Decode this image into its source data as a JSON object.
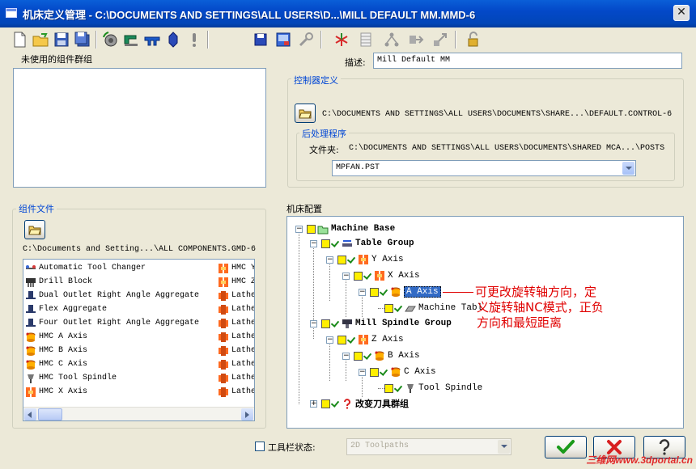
{
  "window": {
    "title": "机床定义管理 - C:\\DOCUMENTS AND SETTINGS\\ALL USERS\\D...\\MILL DEFAULT MM.MMD-6",
    "close": "✕"
  },
  "unused_group": {
    "label": "未使用的组件群组"
  },
  "description": {
    "label": "描述:",
    "value": "Mill Default MM"
  },
  "controller": {
    "label": "控制器定义",
    "path": "C:\\DOCUMENTS AND SETTINGS\\ALL USERS\\DOCUMENTS\\SHARE...\\DEFAULT.CONTROL-6"
  },
  "post": {
    "label": "后处理程序",
    "folder_label": "文件夹:",
    "folder_path": "C:\\DOCUMENTS AND SETTINGS\\ALL USERS\\DOCUMENTS\\SHARED MCA...\\POSTS",
    "selected": "MPFAN.PST"
  },
  "component_file": {
    "label": "组件文件",
    "path": "C:\\Documents and Setting...\\ALL COMPONENTS.GMD-6"
  },
  "component_list": {
    "left": [
      {
        "label": "Automatic Tool Changer",
        "icon": "tool-changer-icon"
      },
      {
        "label": "Drill Block",
        "icon": "drill-block-icon"
      },
      {
        "label": "Dual Outlet Right Angle Aggregate",
        "icon": "aggregate-icon"
      },
      {
        "label": "Flex Aggregate",
        "icon": "aggregate-icon"
      },
      {
        "label": "Four Outlet Right Angle Aggregate",
        "icon": "aggregate-icon"
      },
      {
        "label": "HMC A Axis",
        "icon": "rotary-axis-icon"
      },
      {
        "label": "HMC B Axis",
        "icon": "rotary-axis-icon"
      },
      {
        "label": "HMC C Axis",
        "icon": "rotary-axis-icon"
      },
      {
        "label": "HMC Tool Spindle",
        "icon": "spindle-icon"
      },
      {
        "label": "HMC X Axis",
        "icon": "linear-axis-icon"
      }
    ],
    "right": [
      {
        "label": "HMC Y",
        "icon": "linear-axis-icon"
      },
      {
        "label": "HMC Z",
        "icon": "linear-axis-icon"
      },
      {
        "label": "Lathe",
        "icon": "lathe-icon"
      },
      {
        "label": "Lathe",
        "icon": "lathe-icon"
      },
      {
        "label": "Lathe",
        "icon": "lathe-icon"
      },
      {
        "label": "Lathe",
        "icon": "lathe-icon"
      },
      {
        "label": "Lathe",
        "icon": "lathe-icon"
      },
      {
        "label": "Lathe",
        "icon": "lathe-icon"
      },
      {
        "label": "Lathe",
        "icon": "lathe-icon"
      },
      {
        "label": "Lathe",
        "icon": "lathe-icon"
      }
    ]
  },
  "machine_config": {
    "label": "机床配置",
    "nodes": [
      {
        "label": "Machine Base",
        "icon": "machine-base-icon"
      },
      {
        "label": "Table Group",
        "icon": "table-group-icon"
      },
      {
        "label": "Y Axis",
        "icon": "linear-axis-icon"
      },
      {
        "label": "X Axis",
        "icon": "linear-axis-icon"
      },
      {
        "label": "A Axis",
        "icon": "rotary-axis-icon"
      },
      {
        "label": "Machine Tabl",
        "icon": "machine-table-icon"
      },
      {
        "label": "Mill Spindle Group",
        "icon": "spindle-group-icon"
      },
      {
        "label": "Z Axis",
        "icon": "linear-axis-icon"
      },
      {
        "label": "B Axis",
        "icon": "rotary-axis-icon"
      },
      {
        "label": "C Axis",
        "icon": "rotary-axis-icon"
      },
      {
        "label": "Tool Spindle",
        "icon": "spindle-icon"
      },
      {
        "label": "改变刀具群组",
        "icon": "question-icon"
      }
    ]
  },
  "annotation": {
    "lines": [
      "可更改旋转轴方向，定",
      "义旋转轴NC模式，正负",
      "方向和最短距离"
    ]
  },
  "toolbar_state": {
    "label": "工具栏状态:",
    "value": "2D Toolpaths"
  },
  "buttons": {
    "ok": "ok-icon",
    "cancel": "cancel-icon",
    "help": "help-icon"
  },
  "watermark": "三维网www.3dportal.cn",
  "colors": {
    "title_bar": "#0348c8",
    "group_label": "#0046d5",
    "annotation": "#e00000",
    "checkbox_fill": "#ffef00",
    "dialog_bg": "#ece9d8"
  }
}
